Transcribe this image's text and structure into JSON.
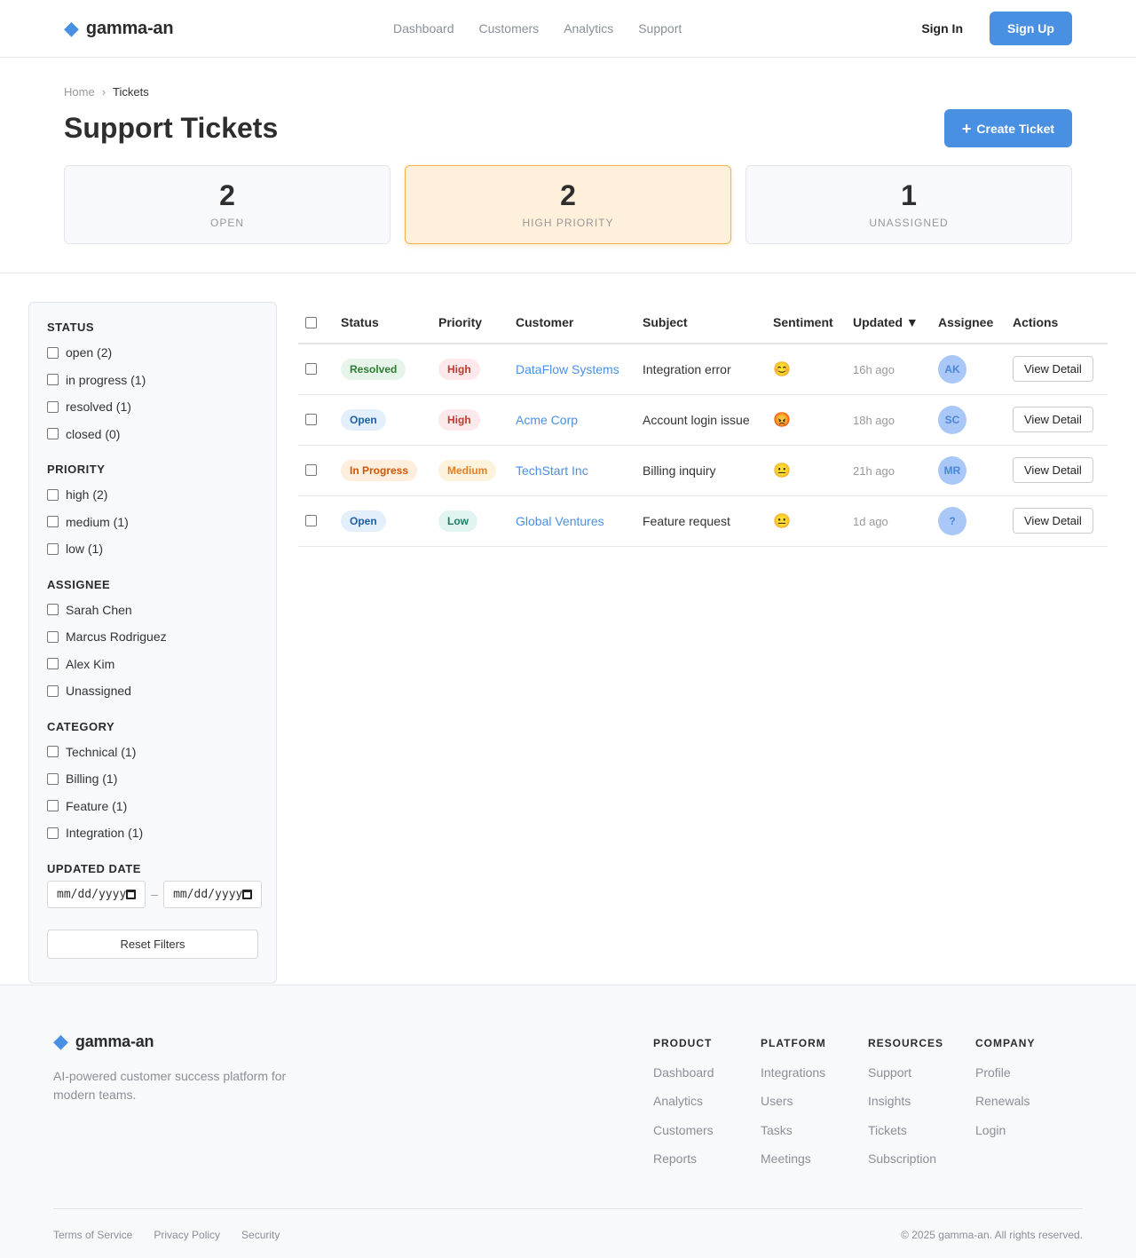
{
  "header": {
    "brand": "gamma-an",
    "nav": [
      "Dashboard",
      "Customers",
      "Analytics",
      "Support"
    ],
    "sign_in": "Sign In",
    "sign_up": "Sign Up"
  },
  "page": {
    "breadcrumb": [
      "Home",
      "Tickets"
    ],
    "title": "Support Tickets",
    "create_label": "Create Ticket",
    "stats": [
      {
        "value": "2",
        "label": "OPEN"
      },
      {
        "value": "2",
        "label": "HIGH PRIORITY"
      },
      {
        "value": "1",
        "label": "UNASSIGNED"
      }
    ]
  },
  "filters": {
    "groups": [
      {
        "title": "STATUS",
        "options": [
          "open (2)",
          "in progress (1)",
          "resolved (1)",
          "closed (0)"
        ]
      },
      {
        "title": "PRIORITY",
        "options": [
          "high (2)",
          "medium (1)",
          "low (1)"
        ]
      },
      {
        "title": "ASSIGNEE",
        "options": [
          "Sarah Chen",
          "Marcus Rodriguez",
          "Alex Kim",
          "Unassigned"
        ]
      },
      {
        "title": "CATEGORY",
        "options": [
          "Technical (1)",
          "Billing (1)",
          "Feature (1)",
          "Integration (1)"
        ]
      }
    ],
    "date_title": "UPDATED DATE",
    "date_placeholder": "mm/dd/yyyy",
    "date_separator": "–",
    "reset_label": "Reset Filters"
  },
  "table": {
    "columns": [
      "Status",
      "Priority",
      "Customer",
      "Subject",
      "Sentiment",
      "Updated ▼",
      "Assignee",
      "Actions"
    ],
    "rows": [
      {
        "status": "Resolved",
        "priority": "High",
        "customer": "DataFlow Systems",
        "subject": "Integration error",
        "sentiment": "😊",
        "updated": "16h ago",
        "assignee": "AK",
        "action": "View Detail"
      },
      {
        "status": "Open",
        "priority": "High",
        "customer": "Acme Corp",
        "subject": "Account login issue",
        "sentiment": "😡",
        "updated": "18h ago",
        "assignee": "SC",
        "action": "View Detail"
      },
      {
        "status": "In Progress",
        "priority": "Medium",
        "customer": "TechStart Inc",
        "subject": "Billing inquiry",
        "sentiment": "😐",
        "updated": "21h ago",
        "assignee": "MR",
        "action": "View Detail"
      },
      {
        "status": "Open",
        "priority": "Low",
        "customer": "Global Ventures",
        "subject": "Feature request",
        "sentiment": "😐",
        "updated": "1d ago",
        "assignee": "?",
        "action": "View Detail"
      }
    ]
  },
  "footer": {
    "brand": "gamma-an",
    "description": "AI-powered customer success platform for modern teams.",
    "columns": [
      {
        "title": "PRODUCT",
        "links": [
          "Dashboard",
          "Analytics",
          "Customers",
          "Reports"
        ]
      },
      {
        "title": "PLATFORM",
        "links": [
          "Integrations",
          "Users",
          "Tasks",
          "Meetings"
        ]
      },
      {
        "title": "RESOURCES",
        "links": [
          "Support",
          "Insights",
          "Tickets",
          "Subscription"
        ]
      },
      {
        "title": "COMPANY",
        "links": [
          "Profile",
          "Renewals",
          "Login"
        ]
      }
    ],
    "legal": [
      "Terms of Service",
      "Privacy Policy",
      "Security"
    ],
    "copyright": "© 2025 gamma-an. All rights reserved."
  },
  "colors": {
    "accent": "#4a90e2",
    "warning_card": "#fff0dc"
  }
}
